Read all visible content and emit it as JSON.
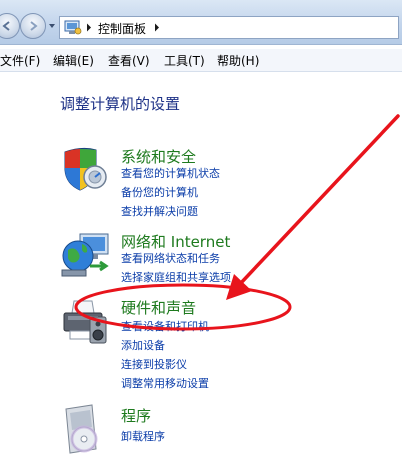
{
  "address_bar": {
    "crumbs": [
      "控制面板"
    ],
    "icons": [
      "back-arrow-icon",
      "forward-arrow-icon",
      "control-panel-icon",
      "breadcrumb-chevron-icon"
    ]
  },
  "menu": {
    "file": "文件(F)",
    "edit": "编辑(E)",
    "view": "查看(V)",
    "tools": "工具(T)",
    "help": "帮助(H)"
  },
  "page_title": "调整计算机的设置",
  "categories": [
    {
      "heading": "系统和安全",
      "icon": "shield-security-icon",
      "links": [
        "查看您的计算机状态",
        "备份您的计算机",
        "查找并解决问题"
      ]
    },
    {
      "heading": "网络和 Internet",
      "icon": "network-globe-icon",
      "links": [
        "查看网络状态和任务",
        "选择家庭组和共享选项"
      ]
    },
    {
      "heading": "硬件和声音",
      "icon": "printer-hardware-icon",
      "links": [
        "查看设备和打印机",
        "添加设备",
        "连接到投影仪",
        "调整常用移动设置"
      ]
    },
    {
      "heading": "程序",
      "icon": "programs-disc-icon",
      "links": [
        "卸载程序"
      ]
    }
  ],
  "annotation": {
    "color": "#e8141c",
    "shapes": [
      "highlight-ellipse",
      "pointer-arrow"
    ]
  }
}
